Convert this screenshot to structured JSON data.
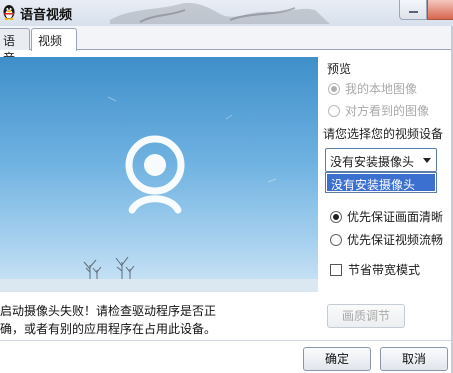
{
  "window": {
    "title": "语音视频",
    "app_icon": "qq-penguin-icon"
  },
  "tabs": [
    {
      "label": "语音",
      "active": false
    },
    {
      "label": "视频",
      "active": true
    }
  ],
  "preview": {
    "title": "预览",
    "options": [
      {
        "label": "我的本地图像",
        "selected": true,
        "enabled": false
      },
      {
        "label": "对方看到的图像",
        "selected": false,
        "enabled": false
      }
    ],
    "error_message": "启动摄像头失败！请检查驱动程序是否正确，或者有别的应用程序在占用此设备。"
  },
  "device": {
    "prompt": "请您选择您的视频设备",
    "selected": "没有安装摄像头",
    "dropdown_option": "没有安装摄像头"
  },
  "quality": {
    "options": [
      {
        "label": "优先保证画面清晰",
        "selected": true
      },
      {
        "label": "优先保证视频流畅",
        "selected": false
      }
    ],
    "bandwidth_saving_label": "节省带宽模式",
    "bandwidth_saving_checked": false,
    "adjust_button": "画质调节"
  },
  "footer": {
    "ok_label": "确定",
    "cancel_label": "取消"
  },
  "colors": {
    "selection": "#3b6fd0",
    "sky_top": "#3f8fca",
    "sky_bottom": "#cfe6f6"
  }
}
